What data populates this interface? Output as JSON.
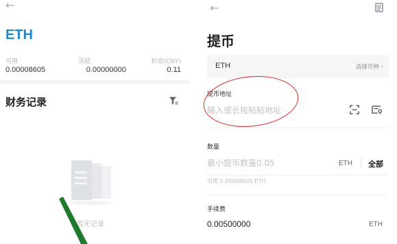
{
  "left": {
    "back_glyph": "←",
    "coin_title": "ETH",
    "balances": {
      "available_label": "可用",
      "frozen_label": "冻结",
      "converted_label": "折合(CNY)",
      "available_value": "0.00008605",
      "frozen_value": "0.00000000",
      "converted_value": "0.11"
    },
    "records_title": "财务记录",
    "filter_icon": "filter-icon",
    "empty_text": "暂无记录"
  },
  "right": {
    "back_glyph": "←",
    "top_right_icon": "receipt-icon",
    "page_title": "提币",
    "coin_select": {
      "coin": "ETH",
      "hint": "选择币种 ›"
    },
    "address": {
      "label": "提币地址",
      "placeholder": "输入或长按粘贴地址"
    },
    "quantity": {
      "label": "数量",
      "placeholder": "最小提币数量0.05",
      "unit": "ETH",
      "all_label": "全部"
    },
    "available": "可用 0.00008605 ETH",
    "fee": {
      "label": "手续费",
      "value": "0.00500000",
      "unit": "ETH"
    }
  },
  "colors": {
    "accent_blue": "#1e88d2",
    "annotation_red": "#d23c3c",
    "annotation_green": "#1f7a2e"
  }
}
